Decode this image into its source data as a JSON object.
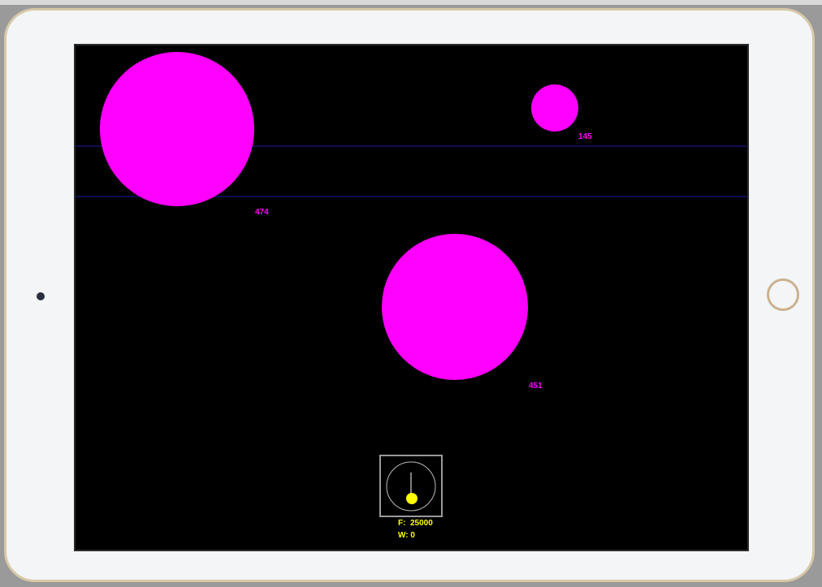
{
  "blobs": [
    {
      "label": "474",
      "color": "#ff00ff"
    },
    {
      "label": "145",
      "color": "#ff00ff"
    },
    {
      "label": "451",
      "color": "#ff00ff"
    }
  ],
  "hud": {
    "food_label": "F:  25000",
    "water_label": "W: 0"
  },
  "colors": {
    "screen_bg": "#000000",
    "lane_line": "#1a1aa8",
    "blob": "#ff00ff",
    "player": "#ffff00",
    "radar_border": "#9a9a9a"
  },
  "icons": {
    "player": "yellow-dot-icon",
    "radar": "radar-icon"
  }
}
